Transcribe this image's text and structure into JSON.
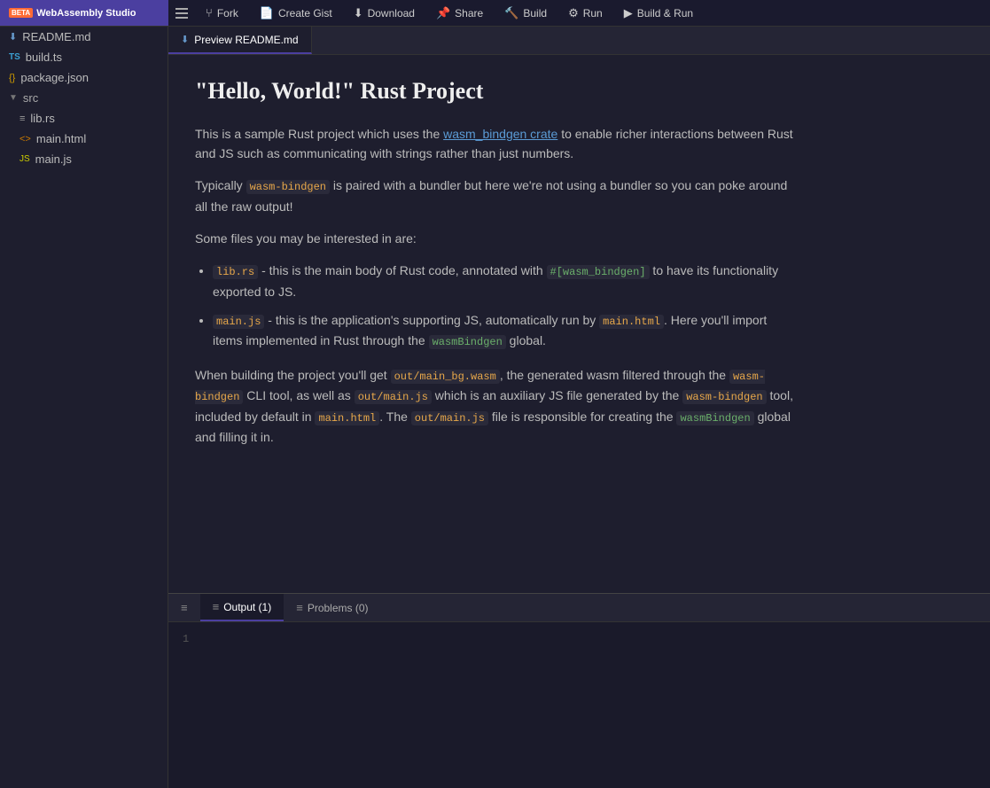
{
  "app": {
    "name": "WebAssembly Studio",
    "beta": "BETA"
  },
  "toolbar": {
    "menu_icon": "≡",
    "fork_label": "Fork",
    "fork_icon": "⑂",
    "gist_label": "Create Gist",
    "gist_icon": "📄",
    "download_label": "Download",
    "download_icon": "⬇",
    "share_label": "Share",
    "share_icon": "📌",
    "build_label": "Build",
    "build_icon": "🔨",
    "run_label": "Run",
    "run_icon": "⚙",
    "build_run_label": "Build & Run",
    "build_run_icon": "▶"
  },
  "sidebar": {
    "files": [
      {
        "name": "README.md",
        "type": "md",
        "indent": 0
      },
      {
        "name": "build.ts",
        "type": "ts",
        "indent": 0
      },
      {
        "name": "package.json",
        "type": "json",
        "indent": 0
      },
      {
        "name": "src",
        "type": "folder",
        "indent": 0
      },
      {
        "name": "lib.rs",
        "type": "rs",
        "indent": 1
      },
      {
        "name": "main.html",
        "type": "html",
        "indent": 1
      },
      {
        "name": "main.js",
        "type": "js",
        "indent": 1
      }
    ]
  },
  "tabs": [
    {
      "name": "Preview README.md",
      "icon": "md",
      "active": true
    }
  ],
  "preview": {
    "title": "\"Hello, World!\" Rust Project",
    "p1_before": "This is a sample Rust project which uses the ",
    "p1_link": "wasm_bindgen crate",
    "p1_after": " to enable richer interactions between Rust and JS such as communicating with strings rather than just numbers.",
    "p2_before": "Typically ",
    "p2_code": "wasm-bindgen",
    "p2_after": " is paired with a bundler but here we're not using a bundler so you can poke around all the raw output!",
    "p3": "Some files you may be interested in are:",
    "bullet1_code1": "lib.rs",
    "bullet1_text1": " - this is the main body of Rust code, annotated with ",
    "bullet1_code2": "#[wasm_bindgen]",
    "bullet1_text2": " to have its functionality exported to JS.",
    "bullet2_code1": "main.js",
    "bullet2_text1": " - this is the application's supporting JS, automatically run by ",
    "bullet2_code2": "main.html",
    "bullet2_text2": ". Here you'll import items implemented in Rust through the ",
    "bullet2_code3": "wasmBindgen",
    "bullet2_text3": " global.",
    "p4_before": "When building the project you'll get ",
    "p4_code1": "out/main_bg.wasm",
    "p4_text1": ", the generated wasm filtered through the ",
    "p4_code2": "wasm-bindgen",
    "p4_text2": " CLI tool, as well as ",
    "p4_code3": "out/main.js",
    "p4_text3": " which is an auxiliary JS file generated by the ",
    "p4_code4": "wasm-bindgen",
    "p4_text4": " tool, included by default in ",
    "p4_code5": "main.html",
    "p4_text5": ". The ",
    "p4_code6": "out/main.js",
    "p4_text6": " file is responsible for creating the ",
    "p4_code7": "wasmBindgen",
    "p4_text7": " global and filling it in."
  },
  "bottom_panel": {
    "tabs": [
      {
        "label": "Output (1)",
        "active": true
      },
      {
        "label": "Problems (0)",
        "active": false
      }
    ],
    "line_numbers": [
      "1"
    ]
  }
}
